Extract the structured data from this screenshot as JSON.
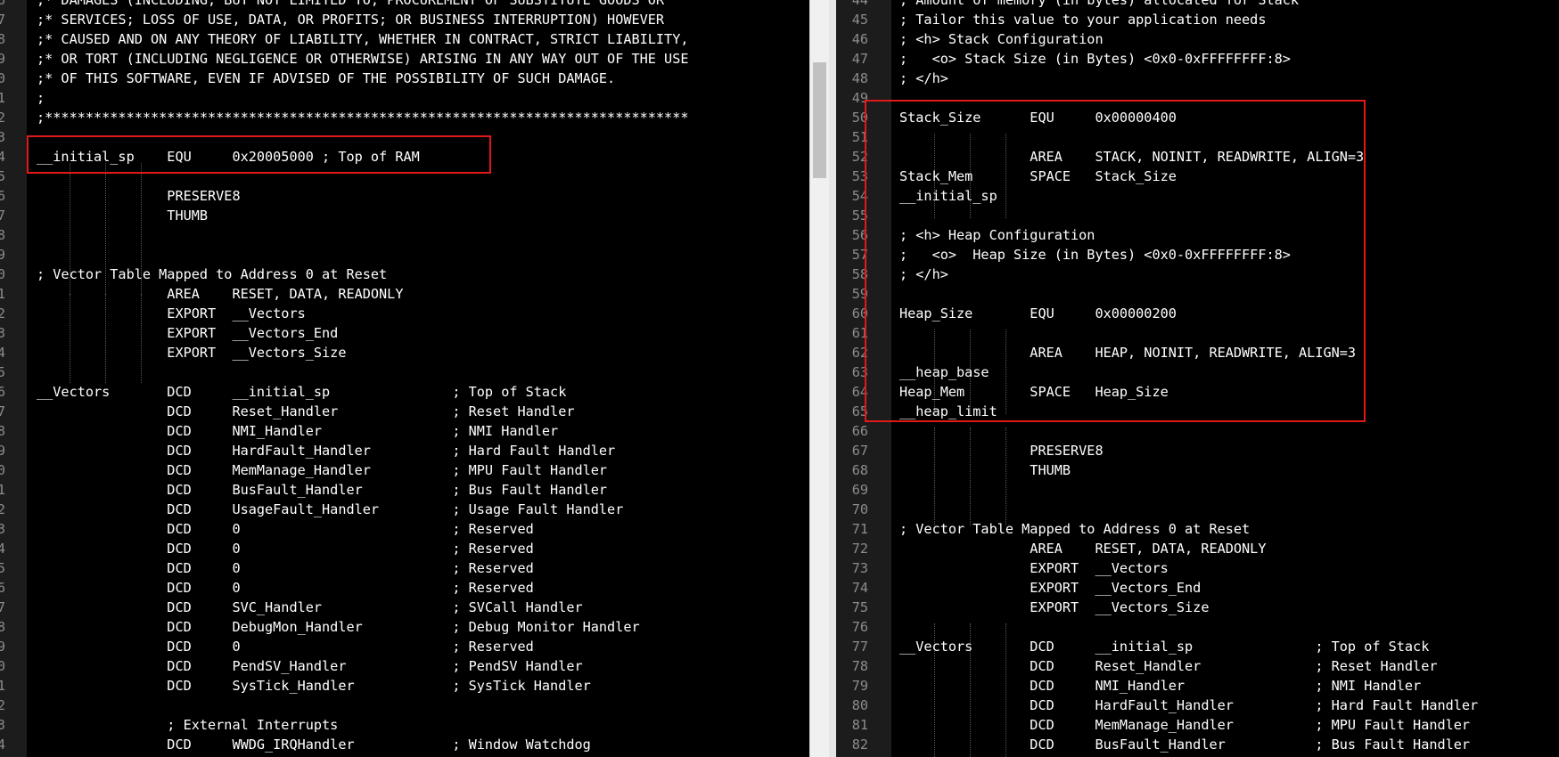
{
  "left_editor": {
    "lines": [
      {
        "num": "6",
        "text": ";* DAMAGES (INCLUDING, BUT NOT LIMITED TO, PROCUREMENT OF SUBSTITUTE GOODS OR"
      },
      {
        "num": "7",
        "text": ";* SERVICES; LOSS OF USE, DATA, OR PROFITS; OR BUSINESS INTERRUPTION) HOWEVER"
      },
      {
        "num": "8",
        "text": ";* CAUSED AND ON ANY THEORY OF LIABILITY, WHETHER IN CONTRACT, STRICT LIABILITY,"
      },
      {
        "num": "9",
        "text": ";* OR TORT (INCLUDING NEGLIGENCE OR OTHERWISE) ARISING IN ANY WAY OUT OF THE USE"
      },
      {
        "num": "0",
        "text": ";* OF THIS SOFTWARE, EVEN IF ADVISED OF THE POSSIBILITY OF SUCH DAMAGE."
      },
      {
        "num": "1",
        "text": ";"
      },
      {
        "num": "2",
        "text": ";*******************************************************************************"
      },
      {
        "num": "3",
        "text": ""
      },
      {
        "num": "4",
        "text": "__initial_sp    EQU     0x20005000 ; Top of RAM"
      },
      {
        "num": "5",
        "text": ""
      },
      {
        "num": "6",
        "text": "                PRESERVE8"
      },
      {
        "num": "7",
        "text": "                THUMB"
      },
      {
        "num": "8",
        "text": ""
      },
      {
        "num": "9",
        "text": ""
      },
      {
        "num": "0",
        "text": "; Vector Table Mapped to Address 0 at Reset"
      },
      {
        "num": "1",
        "text": "                AREA    RESET, DATA, READONLY"
      },
      {
        "num": "2",
        "text": "                EXPORT  __Vectors"
      },
      {
        "num": "3",
        "text": "                EXPORT  __Vectors_End"
      },
      {
        "num": "4",
        "text": "                EXPORT  __Vectors_Size"
      },
      {
        "num": "5",
        "text": ""
      },
      {
        "num": "6",
        "text": "__Vectors       DCD     __initial_sp               ; Top of Stack"
      },
      {
        "num": "7",
        "text": "                DCD     Reset_Handler              ; Reset Handler"
      },
      {
        "num": "8",
        "text": "                DCD     NMI_Handler                ; NMI Handler"
      },
      {
        "num": "9",
        "text": "                DCD     HardFault_Handler          ; Hard Fault Handler"
      },
      {
        "num": "0",
        "text": "                DCD     MemManage_Handler          ; MPU Fault Handler"
      },
      {
        "num": "1",
        "text": "                DCD     BusFault_Handler           ; Bus Fault Handler"
      },
      {
        "num": "2",
        "text": "                DCD     UsageFault_Handler         ; Usage Fault Handler"
      },
      {
        "num": "3",
        "text": "                DCD     0                          ; Reserved"
      },
      {
        "num": "4",
        "text": "                DCD     0                          ; Reserved"
      },
      {
        "num": "5",
        "text": "                DCD     0                          ; Reserved"
      },
      {
        "num": "6",
        "text": "                DCD     0                          ; Reserved"
      },
      {
        "num": "7",
        "text": "                DCD     SVC_Handler                ; SVCall Handler"
      },
      {
        "num": "8",
        "text": "                DCD     DebugMon_Handler           ; Debug Monitor Handler"
      },
      {
        "num": "9",
        "text": "                DCD     0                          ; Reserved"
      },
      {
        "num": "0",
        "text": "                DCD     PendSV_Handler             ; PendSV Handler"
      },
      {
        "num": "1",
        "text": "                DCD     SysTick_Handler            ; SysTick Handler"
      },
      {
        "num": "2",
        "text": ""
      },
      {
        "num": "3",
        "text": "                ; External Interrupts"
      },
      {
        "num": "4",
        "text": "                DCD     WWDG_IRQHandler            ; Window Watchdog"
      }
    ]
  },
  "right_editor": {
    "lines": [
      {
        "num": "44",
        "text": "; Amount of memory (in bytes) allocated for Stack"
      },
      {
        "num": "45",
        "text": "; Tailor this value to your application needs"
      },
      {
        "num": "46",
        "text": "; <h> Stack Configuration"
      },
      {
        "num": "47",
        "text": ";   <o> Stack Size (in Bytes) <0x0-0xFFFFFFFF:8>"
      },
      {
        "num": "48",
        "text": "; </h>"
      },
      {
        "num": "49",
        "text": ""
      },
      {
        "num": "50",
        "text": "Stack_Size      EQU     0x00000400"
      },
      {
        "num": "51",
        "text": ""
      },
      {
        "num": "52",
        "text": "                AREA    STACK, NOINIT, READWRITE, ALIGN=3"
      },
      {
        "num": "53",
        "text": "Stack_Mem       SPACE   Stack_Size"
      },
      {
        "num": "54",
        "text": "__initial_sp"
      },
      {
        "num": "55",
        "text": ""
      },
      {
        "num": "56",
        "text": "; <h> Heap Configuration"
      },
      {
        "num": "57",
        "text": ";   <o>  Heap Size (in Bytes) <0x0-0xFFFFFFFF:8>"
      },
      {
        "num": "58",
        "text": "; </h>"
      },
      {
        "num": "59",
        "text": ""
      },
      {
        "num": "60",
        "text": "Heap_Size       EQU     0x00000200"
      },
      {
        "num": "61",
        "text": ""
      },
      {
        "num": "62",
        "text": "                AREA    HEAP, NOINIT, READWRITE, ALIGN=3"
      },
      {
        "num": "63",
        "text": "__heap_base"
      },
      {
        "num": "64",
        "text": "Heap_Mem        SPACE   Heap_Size"
      },
      {
        "num": "65",
        "text": "__heap_limit"
      },
      {
        "num": "66",
        "text": ""
      },
      {
        "num": "67",
        "text": "                PRESERVE8"
      },
      {
        "num": "68",
        "text": "                THUMB"
      },
      {
        "num": "69",
        "text": ""
      },
      {
        "num": "70",
        "text": ""
      },
      {
        "num": "71",
        "text": "; Vector Table Mapped to Address 0 at Reset"
      },
      {
        "num": "72",
        "text": "                AREA    RESET, DATA, READONLY"
      },
      {
        "num": "73",
        "text": "                EXPORT  __Vectors"
      },
      {
        "num": "74",
        "text": "                EXPORT  __Vectors_End"
      },
      {
        "num": "75",
        "text": "                EXPORT  __Vectors_Size"
      },
      {
        "num": "76",
        "text": ""
      },
      {
        "num": "77",
        "text": "__Vectors       DCD     __initial_sp               ; Top of Stack"
      },
      {
        "num": "78",
        "text": "                DCD     Reset_Handler              ; Reset Handler"
      },
      {
        "num": "79",
        "text": "                DCD     NMI_Handler                ; NMI Handler"
      },
      {
        "num": "80",
        "text": "                DCD     HardFault_Handler          ; Hard Fault Handler"
      },
      {
        "num": "81",
        "text": "                DCD     MemManage_Handler          ; MPU Fault Handler"
      },
      {
        "num": "82",
        "text": "                DCD     BusFault_Handler           ; Bus Fault Handler"
      }
    ]
  },
  "colors": {
    "background": "#000000",
    "text": "#ffffff",
    "line_number": "#8c8c8c",
    "highlight_box": "#e01919"
  }
}
